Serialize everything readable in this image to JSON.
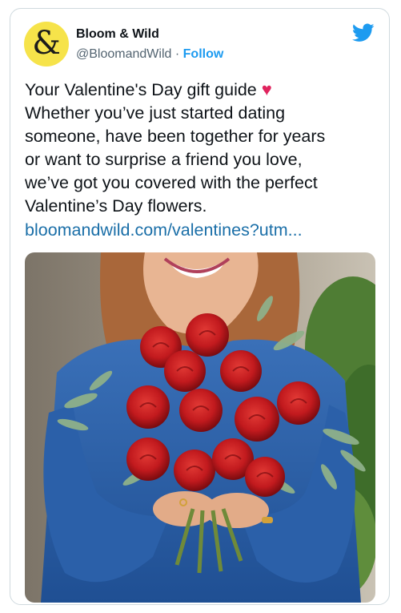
{
  "tweet": {
    "avatar_text": "&",
    "display_name": "Bloom & Wild",
    "handle": "@BloomandWild",
    "separator": "·",
    "follow_label": "Follow",
    "text_first_line": "Your Valentine's Day gift guide",
    "text_body": "Whether you’ve just started dating\nsomeone, have been together for years\nor want to surprise a friend you love,\nwe’ve got you covered with the perfect\nValentine’s Day flowers.",
    "link": "bloomandwild.com/valentines?utm..."
  },
  "icons": {
    "brand": "twitter-bird-icon",
    "emoji": "red-heart-icon"
  },
  "colors": {
    "accent": "#1d9bf0",
    "link": "#1b6fa8",
    "avatar_bg": "#f6e34a",
    "sweater": "#2a5fa8",
    "rose": "#c21a1e"
  }
}
